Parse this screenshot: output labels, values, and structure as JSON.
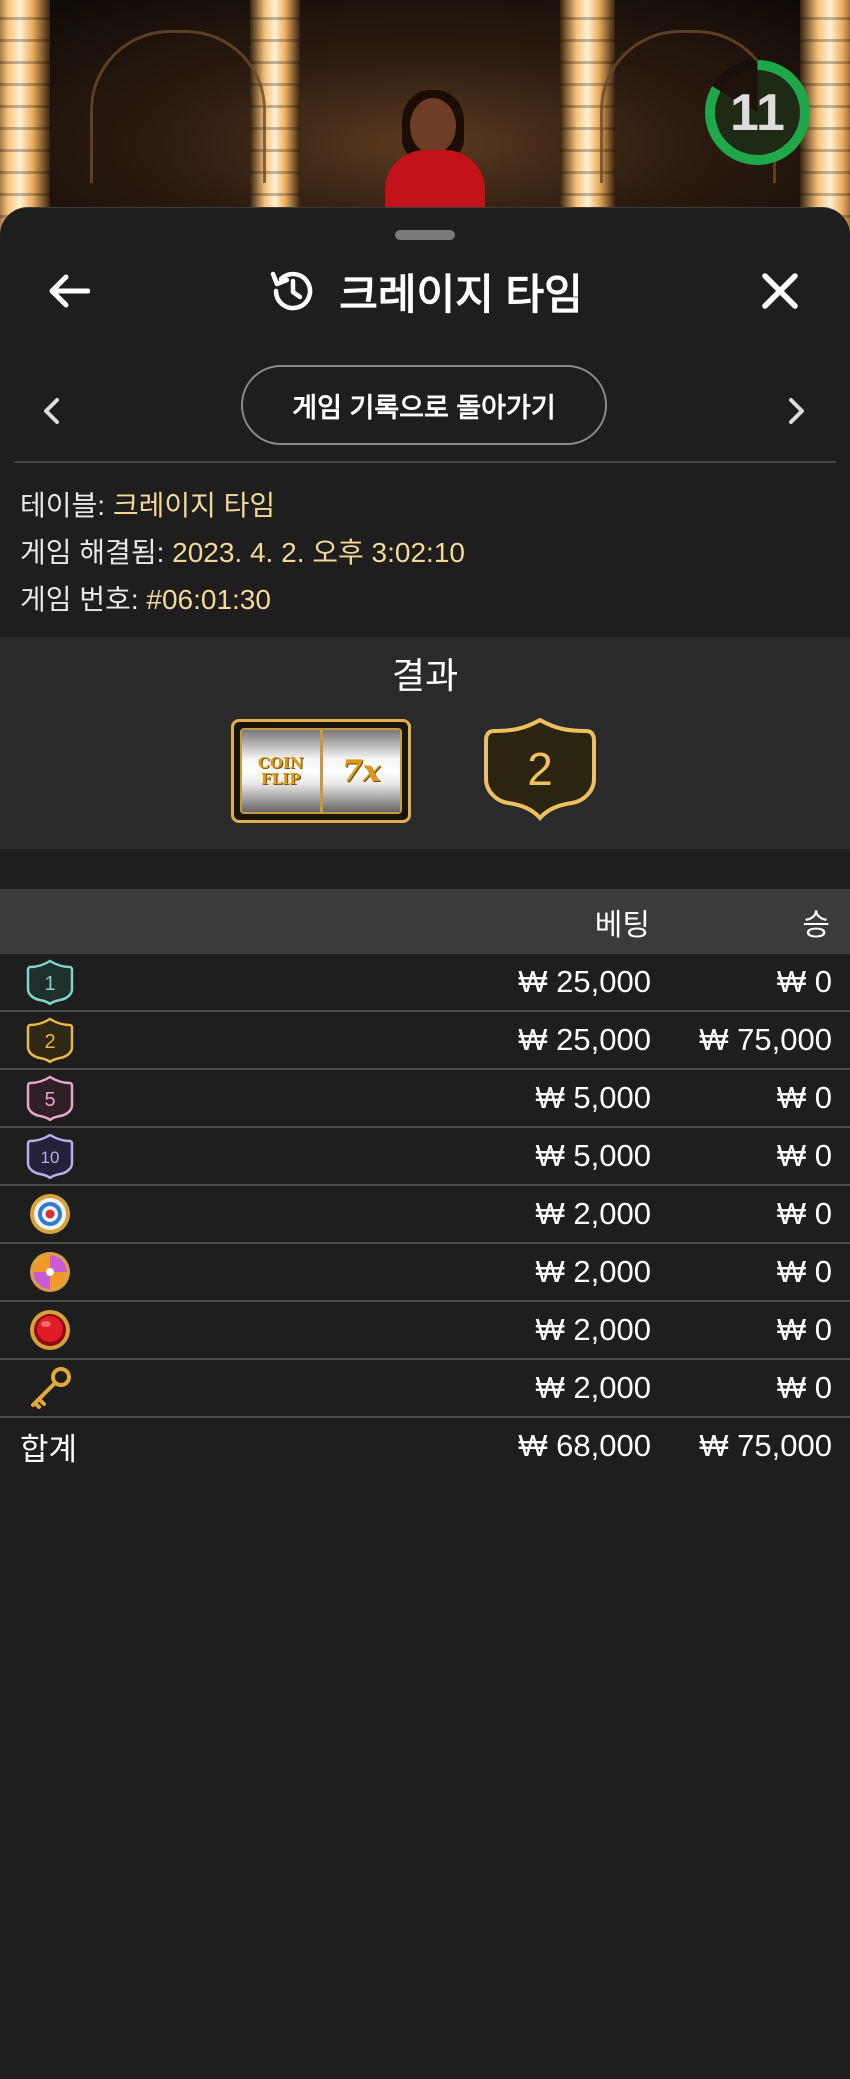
{
  "background": {
    "timer_value": "11"
  },
  "header": {
    "title": "크레이지 타임"
  },
  "nav": {
    "back_to_history_label": "게임 기록으로 돌아가기"
  },
  "details": {
    "table_label": "테이블:",
    "table_value": "크레이지 타임",
    "resolved_label": "게임 해결됨:",
    "resolved_value": "2023. 4. 2. 오후 3:02:10",
    "game_no_label": "게임 번호:",
    "game_no_value": "#06:01:30"
  },
  "result": {
    "title": "결과",
    "slot_left": "COIN FLIP",
    "slot_right": "7x",
    "outcome": "2"
  },
  "bets_table": {
    "col_bet": "베팅",
    "col_win": "승",
    "rows": [
      {
        "segment": "1",
        "icon": "number-1-badge-icon",
        "bet": "₩ 25,000",
        "win": "₩ 0"
      },
      {
        "segment": "2",
        "icon": "number-2-badge-icon",
        "bet": "₩ 25,000",
        "win": "₩ 75,000"
      },
      {
        "segment": "5",
        "icon": "number-5-badge-icon",
        "bet": "₩ 5,000",
        "win": "₩ 0"
      },
      {
        "segment": "10",
        "icon": "number-10-badge-icon",
        "bet": "₩ 5,000",
        "win": "₩ 0"
      },
      {
        "segment": "",
        "icon": "coin-flip-target-icon",
        "bet": "₩ 2,000",
        "win": "₩ 0"
      },
      {
        "segment": "",
        "icon": "pachinko-candy-icon",
        "bet": "₩ 2,000",
        "win": "₩ 0"
      },
      {
        "segment": "",
        "icon": "cash-hunt-red-button-icon",
        "bet": "₩ 2,000",
        "win": "₩ 0"
      },
      {
        "segment": "",
        "icon": "crazy-time-key-icon",
        "bet": "₩ 2,000",
        "win": "₩ 0"
      }
    ],
    "total_label": "합계",
    "total_bet": "₩ 68,000",
    "total_win": "₩ 75,000"
  },
  "colors": {
    "accent_gold": "#f3d998",
    "badge_1": "#7fd6c8",
    "badge_2": "#e9b84a",
    "badge_5": "#e7a6c6",
    "badge_10": "#b7b0e8",
    "timer_green": "#1ea84a"
  }
}
